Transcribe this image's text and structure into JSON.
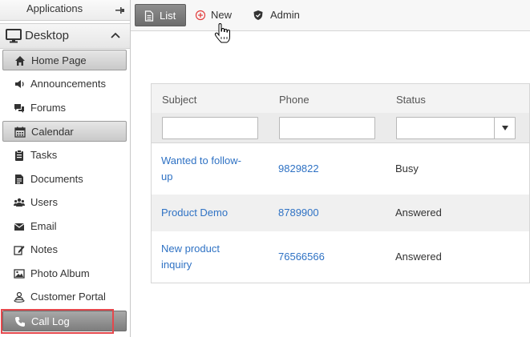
{
  "sidebar": {
    "applications_title": "Applications",
    "section_title": "Desktop",
    "items": [
      {
        "label": "Home Page",
        "icon": "home-icon",
        "state": "active"
      },
      {
        "label": "Announcements",
        "icon": "speaker-icon",
        "state": "normal"
      },
      {
        "label": "Forums",
        "icon": "chat-icon",
        "state": "normal"
      },
      {
        "label": "Calendar",
        "icon": "calendar-icon",
        "state": "active"
      },
      {
        "label": "Tasks",
        "icon": "clipboard-icon",
        "state": "normal"
      },
      {
        "label": "Documents",
        "icon": "document-icon",
        "state": "normal"
      },
      {
        "label": "Users",
        "icon": "users-icon",
        "state": "normal"
      },
      {
        "label": "Email",
        "icon": "envelope-icon",
        "state": "normal"
      },
      {
        "label": "Notes",
        "icon": "edit-icon",
        "state": "normal"
      },
      {
        "label": "Photo Album",
        "icon": "image-icon",
        "state": "normal"
      },
      {
        "label": "Customer Portal",
        "icon": "portal-icon",
        "state": "normal"
      },
      {
        "label": "Call Log",
        "icon": "phone-icon",
        "state": "selected"
      }
    ]
  },
  "toolbar": {
    "list_label": "List",
    "new_label": "New",
    "admin_label": "Admin"
  },
  "grid": {
    "columns": [
      "Subject",
      "Phone",
      "Status"
    ],
    "filters": {
      "subject": "",
      "phone": "",
      "status": ""
    },
    "rows": [
      {
        "subject_line1": "Wanted to follow-",
        "subject_line2": "up",
        "phone": "9829822",
        "status": "Busy"
      },
      {
        "subject_line1": "Product Demo",
        "subject_line2": "",
        "phone": "8789900",
        "status": "Answered"
      },
      {
        "subject_line1": "New product",
        "subject_line2": "inquiry",
        "phone": "76566566",
        "status": "Answered"
      }
    ]
  },
  "colors": {
    "link": "#2f72c4",
    "highlight": "#e5484d",
    "new_icon": "#e23b3b"
  }
}
